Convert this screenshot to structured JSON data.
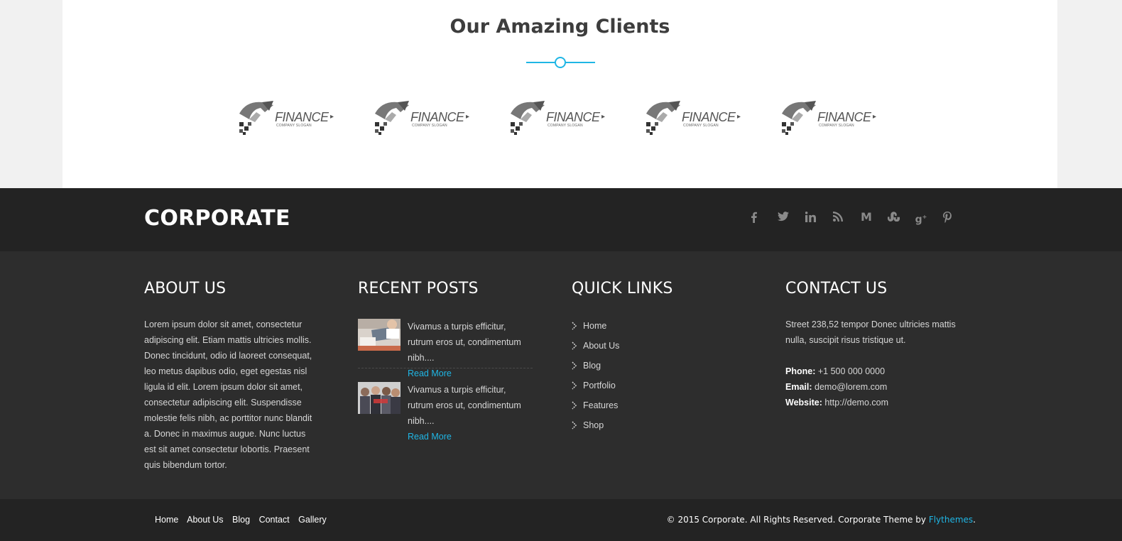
{
  "clients": {
    "title": "Our Amazing Clients",
    "logos": [
      {
        "word": "FINANCE",
        "slogan": "COMPANY SLOGAN"
      },
      {
        "word": "FINANCE",
        "slogan": "COMPANY SLOGAN"
      },
      {
        "word": "FINANCE",
        "slogan": "COMPANY SLOGAN"
      },
      {
        "word": "FINANCE",
        "slogan": "COMPANY SLOGAN"
      },
      {
        "word": "FINANCE",
        "slogan": "COMPANY SLOGAN"
      }
    ]
  },
  "footer_top": {
    "brand": "CORPORATE",
    "social": [
      "facebook-icon",
      "twitter-icon",
      "linkedin-icon",
      "rss-icon",
      "medium-icon",
      "stumbleupon-icon",
      "google-plus-icon",
      "pinterest-icon"
    ]
  },
  "about": {
    "title": "ABOUT US",
    "text": "Lorem ipsum dolor sit amet, consectetur adipiscing elit. Etiam mattis ultricies mollis. Donec tincidunt, odio id laoreet consequat, leo metus dapibus odio, eget egestas nisl ligula id elit. Lorem ipsum dolor sit amet, consectetur adipiscing elit. Suspendisse molestie felis nibh, ac porttitor nunc blandit a. Donec in maximus augue. Nunc luctus est sit amet consectetur lobortis. Praesent quis bibendum tortor."
  },
  "recent_posts": {
    "title": "RECENT POSTS",
    "posts": [
      {
        "excerpt": "Vivamus a turpis efficitur, rutrum eros ut, condimentum nibh....",
        "more": "Read More"
      },
      {
        "excerpt": "Vivamus a turpis efficitur, rutrum eros ut, condimentum nibh....",
        "more": "Read More"
      }
    ]
  },
  "quick_links": {
    "title": "QUICK LINKS",
    "items": [
      "Home",
      "About Us",
      "Blog",
      "Portfolio",
      "Features",
      "Shop"
    ]
  },
  "contact": {
    "title": "CONTACT US",
    "address": "Street 238,52 tempor Donec ultricies mattis nulla, suscipit risus tristique ut.",
    "phone_label": "Phone:",
    "phone": "+1 500 000 0000",
    "email_label": "Email:",
    "email": "demo@lorem.com",
    "website_label": "Website:",
    "website": "http://demo.com"
  },
  "bottom": {
    "nav": [
      "Home",
      "About Us",
      "Blog",
      "Contact",
      "Gallery"
    ],
    "copyright": "© 2015 Corporate. All Rights Reserved. Corporate Theme by",
    "theme_link": "Flythemes",
    "period": "."
  }
}
